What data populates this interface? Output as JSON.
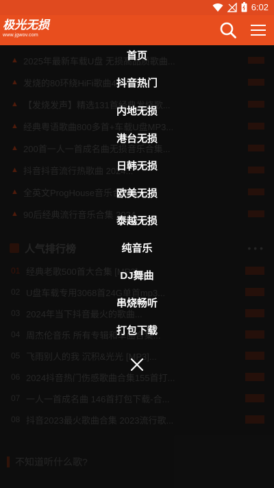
{
  "statusbar": {
    "time": "6:02"
  },
  "header": {
    "logo_main": "极光无损",
    "logo_sub": "www.jgwov.com"
  },
  "background": {
    "news": [
      "2025年最新车载U盘 无损高品质歌曲...",
      "发烧的80环绕HiFi歌曲400首...",
      "【发烧发声】精选131首经典发烧歌...",
      "经典粤语歌曲800多首+车载U盘MP3...",
      "200首一人一首成名曲无损音乐合集...",
      "抖音抖音流行热歌曲 2024...",
      "全英文ProgHouse音乐合集...",
      "90后经典流行音乐合集 2024..."
    ],
    "rank_title": "人气排行榜",
    "rank_more": "• • •",
    "ranks": [
      {
        "num": "01",
        "text": "经典老歌500首大合集 [MP3]..."
      },
      {
        "num": "02",
        "text": "U盘车载专用3068首24G单首mp3..."
      },
      {
        "num": "03",
        "text": "2024年当下抖音最火的歌曲..."
      },
      {
        "num": "04",
        "text": "周杰伦音乐 所有专辑和单曲合集..."
      },
      {
        "num": "05",
        "text": "飞雨别人的我 沉积&光光 [MP3]..."
      },
      {
        "num": "06",
        "text": "2024抖音热门伤感歌曲合集155首打..."
      },
      {
        "num": "07",
        "text": "一人一首成名曲 146首打包下载-合..."
      },
      {
        "num": "08",
        "text": "抖音2023最火歌曲合集 2023流行歌..."
      }
    ],
    "guess_title": "不知道听什么歌?"
  },
  "menu": {
    "items": [
      "首页",
      "抖音热门",
      "内地无损",
      "港台无损",
      "日韩无损",
      "欧美无损",
      "泰越无损",
      "纯音乐",
      "DJ舞曲",
      "串烧畅听",
      "打包下载"
    ]
  },
  "colors": {
    "accent": "#e84e1e",
    "overlay_text": "#ffffff"
  },
  "icons": {
    "search": "search-icon",
    "menu": "hamburger-icon",
    "close": "close-icon",
    "wifi": "wifi-icon",
    "signal": "signal-icon",
    "battery": "battery-icon"
  }
}
